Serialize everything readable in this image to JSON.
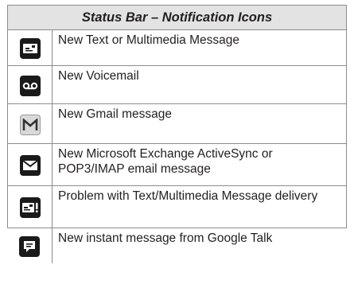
{
  "table": {
    "header": "Status Bar – Notification Icons",
    "rows": [
      {
        "icon": "sms-message-icon",
        "text": "New Text or Multimedia Message"
      },
      {
        "icon": "voicemail-icon",
        "text": "New Voicemail"
      },
      {
        "icon": "gmail-icon",
        "text": "New Gmail message"
      },
      {
        "icon": "email-envelope-icon",
        "text": "New Microsoft Exchange ActiveSync or POP3/IMAP email message"
      },
      {
        "icon": "message-error-icon",
        "text": "Problem with Text/Multimedia Message delivery"
      },
      {
        "icon": "google-talk-icon",
        "text": "New instant message from Google Talk"
      }
    ]
  }
}
